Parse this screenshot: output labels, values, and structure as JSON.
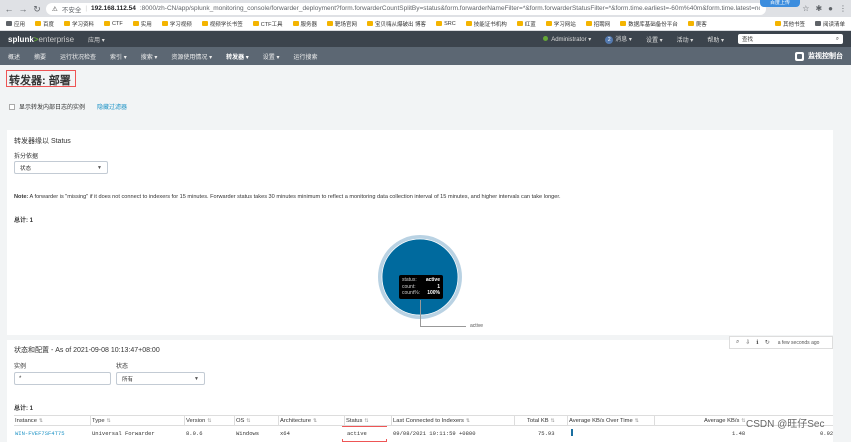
{
  "browser": {
    "insecure_label": "不安全",
    "url_host": "192.168.112.54",
    "url_rest": ":8000/zh-CN/app/splunk_monitoring_console/forwarder_deployment?form.forwarderCountSplitBy=status&form.forwarderNameFilter=*&form.forwarderStatusFilter=*&form.time.earliest=-60m%40m&form.time.latest=now",
    "cloud_badge": "百度上传",
    "bookmarks": [
      "应用",
      "百度",
      "学习资料",
      "CTF",
      "实用",
      "学习视频",
      "视频学长书签",
      "CTF工具",
      "服务器",
      "靶场官网",
      "宝贝嗨从爆破出 博客",
      "SRC",
      "技能证书机构",
      "红蓝",
      "学习网站",
      "招聘网",
      "数据库基础备份平台",
      "爬客"
    ],
    "bookmarks_right": [
      "其他书签",
      "阅读清单"
    ]
  },
  "splunk": {
    "logo_main": "splunk",
    "logo_gt": ">",
    "logo_ent": "enterprise",
    "app_menu": "应用 ▾",
    "user": "Administrator ▾",
    "msg_count": "2",
    "messages": "消息 ▾",
    "settings": "设置 ▾",
    "activity": "活动 ▾",
    "help": "帮助 ▾",
    "find_placeholder": "查找"
  },
  "nav": {
    "items": [
      "概述",
      "摘要",
      "运行状况检查",
      "索引 ▾",
      "搜索 ▾",
      "资源使用情况 ▾",
      "转发器 ▾",
      "设置 ▾",
      "运行搜索"
    ],
    "app_title": "监视控制台"
  },
  "page": {
    "title": "转发器: 部署",
    "show_internal": "显示转发内部日志的实例",
    "hide_filters": "隐藏过滤器"
  },
  "panel1": {
    "title": "转发器缘以 Status",
    "split_label": "拆分依据",
    "split_value": "状态",
    "note_bold": "Note:",
    "note": " A forwarder is \"missing\" if it does not connect to indexers for 15 minutes. Forwarder status takes 30 minutes minimum to reflect a monitoring data collection interval of 15 minutes, and higher intervals can take longer.",
    "total": "总计: 1",
    "tooltip": [
      {
        "k": "status:",
        "v": "active"
      },
      {
        "k": "count:",
        "v": "1"
      },
      {
        "k": "count%:",
        "v": "100%"
      }
    ],
    "slice_label": "active",
    "updated": "a few seconds ago"
  },
  "chart_data": {
    "type": "pie",
    "title": "",
    "slices": [
      {
        "label": "active",
        "value": 1,
        "percent": 100
      }
    ],
    "colors": [
      "#006a9e"
    ]
  },
  "panel2": {
    "title": "状态和配置 - As of 2021-09-08 10:13:47+08:00",
    "instance_label": "实例",
    "instance_value": "*",
    "status_label": "状态",
    "status_value": "所有",
    "total": "总计: 1",
    "columns": [
      "Instance",
      "Type",
      "Version",
      "OS",
      "Architecture",
      "Status",
      "Last Connected to Indexers",
      "Total KB",
      "Average KB/s Over Time",
      "Average KB/s"
    ],
    "rows": [
      [
        "WIN-FVEF7SF4T75",
        "Universal Forwarder",
        "8.0.6",
        "Windows",
        "x64",
        "active",
        "09/08/2021 10:11:59 +0800",
        "75.93",
        "",
        "1.48",
        "0.92"
      ]
    ]
  },
  "watermark": "CSDN @旺仔Sec"
}
